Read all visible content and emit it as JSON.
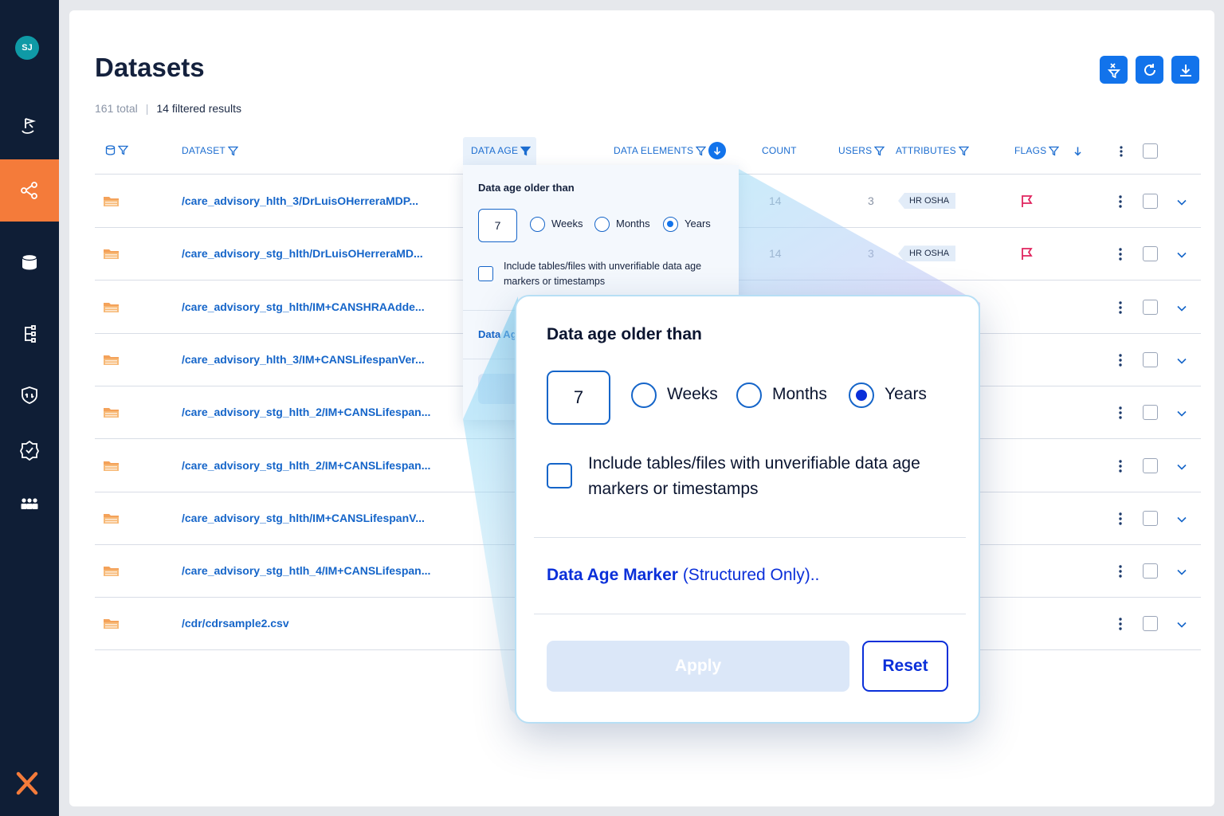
{
  "user": {
    "initials": "SJ"
  },
  "page": {
    "title": "Datasets",
    "total": "161 total",
    "separator": "|",
    "filtered": "14 filtered results"
  },
  "nav": [
    "lineage-icon",
    "graph-icon",
    "database-icon",
    "hierarchy-icon",
    "shield-icon",
    "badge-check-icon",
    "users-icon"
  ],
  "toolbar": [
    "clear-filters-icon",
    "refresh-icon",
    "download-icon"
  ],
  "columns": {
    "dataset": "DATASET",
    "data_age": "DATA AGE",
    "data_elements": "DATA ELEMENTS",
    "count": "COUNT",
    "users": "USERS",
    "attributes": "ATTRIBUTES",
    "flags": "FLAGS"
  },
  "rows": [
    {
      "name": "/care_advisory_hlth_3/DrLuisOHerreraMDP...",
      "count": "14",
      "users": "3",
      "attribute": "HR OSHA",
      "flagged": true
    },
    {
      "name": "/care_advisory_stg_hlth/DrLuisOHerreraMD...",
      "count": "14",
      "users": "3",
      "attribute": "HR OSHA",
      "flagged": true
    },
    {
      "name": "/care_advisory_stg_hlth/IM+CANSHRAAdde...",
      "count": "",
      "users": "",
      "attribute": "",
      "flagged": false
    },
    {
      "name": "/care_advisory_hlth_3/IM+CANSLifespanVer...",
      "count": "",
      "users": "",
      "attribute": "",
      "flagged": false
    },
    {
      "name": "/care_advisory_stg_hlth_2/IM+CANSLifespan...",
      "count": "",
      "users": "",
      "attribute": "",
      "flagged": false
    },
    {
      "name": "/care_advisory_stg_hlth_2/IM+CANSLifespan...",
      "count": "",
      "users": "",
      "attribute": "",
      "flagged": false
    },
    {
      "name": "/care_advisory_stg_hlth/IM+CANSLifespanV...",
      "count": "",
      "users": "",
      "attribute": "",
      "flagged": false
    },
    {
      "name": "/care_advisory_stg_htlh_4/IM+CANSLifespan...",
      "count": "",
      "users": "",
      "attribute": "",
      "flagged": false
    },
    {
      "name": "/cdr/cdrsample2.csv",
      "count": "",
      "users": "",
      "attribute": "",
      "flagged": false
    }
  ],
  "filter": {
    "title": "Data age older than",
    "value": "7",
    "units": [
      "Weeks",
      "Months",
      "Years"
    ],
    "selected_unit": "Years",
    "include_label": "Include tables/files with unverifiable data age markers or timestamps",
    "include_checked": false,
    "marker_label": "Data Age Marker",
    "marker_suffix": "(Structured Only)..",
    "marker_small": "Data Ag",
    "apply_label": "Apply",
    "reset_label": "Reset"
  },
  "colors": {
    "accent": "#1273eb",
    "sidebar": "#0f1e36",
    "active_nav": "#f47b3a",
    "flag": "#e0245e"
  }
}
